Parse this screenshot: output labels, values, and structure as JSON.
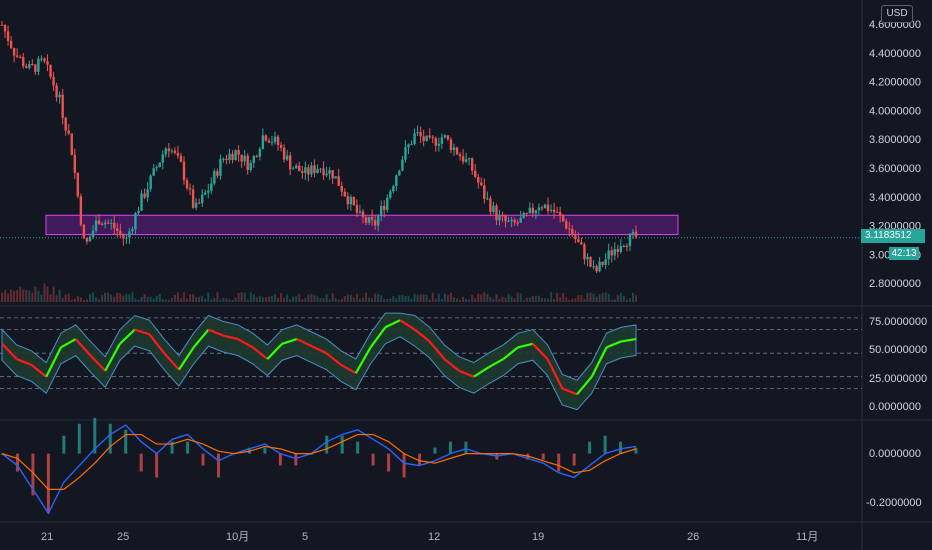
{
  "currency": "USD",
  "last_price": "3.1183512",
  "countdown": "42:13",
  "time_axis": [
    "21",
    "25",
    "10月",
    "5",
    "12",
    "19",
    "26",
    "11月"
  ],
  "price_axis": [
    "4.6000000",
    "4.4000000",
    "4.2000000",
    "4.0000000",
    "3.8000000",
    "3.6000000",
    "3.4000000",
    "3.2000000",
    "3.0000000",
    "2.8000000"
  ],
  "osc_axis": [
    "75.0000000",
    "50.0000000",
    "25.0000000",
    "0.0000000"
  ],
  "macd_axis": [
    "0.0000000",
    "-0.2000000"
  ],
  "colors": {
    "bg": "#131722",
    "up": "#26a69a",
    "down": "#ef5350",
    "zone_fill": "#7b1fa2",
    "zone_stroke": "#e040fb",
    "osc_green": "#33ff00",
    "osc_red": "#ff1a1a",
    "band": "#4a90c8",
    "macd": "#2962ff",
    "signal": "#ff6d00"
  },
  "chart_data": [
    {
      "type": "candlestick",
      "title": "",
      "y_unit": "USD",
      "ylim": [
        2.7,
        4.65
      ],
      "x_ticks": [
        "21",
        "25",
        "10月",
        "5",
        "12",
        "19",
        "26",
        "11月"
      ],
      "resistance_zone": [
        3.14,
        3.27
      ],
      "last_price": 3.1183512,
      "close_path": [
        4.55,
        4.35,
        4.25,
        4.3,
        4.1,
        3.75,
        3.05,
        3.25,
        3.2,
        3.1,
        3.35,
        3.55,
        3.75,
        3.6,
        3.3,
        3.45,
        3.65,
        3.7,
        3.6,
        3.82,
        3.75,
        3.6,
        3.55,
        3.6,
        3.55,
        3.4,
        3.25,
        3.2,
        3.4,
        3.65,
        3.82,
        3.75,
        3.8,
        3.7,
        3.6,
        3.4,
        3.25,
        3.2,
        3.25,
        3.35,
        3.3,
        3.2,
        3.05,
        2.88,
        3.0,
        3.1,
        3.12
      ]
    },
    {
      "type": "line",
      "title": "",
      "ylim": [
        0,
        85
      ],
      "levels": [
        80,
        70,
        50,
        30,
        20
      ],
      "values": [
        58,
        45,
        40,
        30,
        55,
        62,
        48,
        35,
        58,
        70,
        66,
        50,
        36,
        55,
        70,
        65,
        62,
        55,
        45,
        58,
        62,
        56,
        50,
        40,
        33,
        55,
        72,
        78,
        70,
        60,
        45,
        35,
        30,
        38,
        45,
        55,
        58,
        45,
        20,
        15,
        30,
        55,
        60,
        62
      ]
    },
    {
      "type": "line",
      "title": "",
      "ylim": [
        -0.27,
        0.12
      ],
      "series": [
        {
          "values": [
            0.0,
            -0.05,
            -0.15,
            -0.25,
            -0.12,
            -0.05,
            0.02,
            0.08,
            0.12,
            0.05,
            0.0,
            0.06,
            0.08,
            0.02,
            -0.03,
            0.0,
            0.02,
            0.04,
            0.0,
            -0.02,
            0.0,
            0.05,
            0.08,
            0.1,
            0.06,
            0.02,
            -0.04,
            -0.05,
            -0.03,
            0.0,
            0.02,
            0.0,
            -0.01,
            0.0,
            -0.02,
            -0.04,
            -0.08,
            -0.1,
            -0.05,
            0.0,
            0.02,
            0.03
          ]
        },
        {
          "values": [
            0.0,
            -0.02,
            -0.08,
            -0.15,
            -0.15,
            -0.1,
            -0.04,
            0.03,
            0.08,
            0.08,
            0.04,
            0.04,
            0.06,
            0.04,
            0.01,
            0.0,
            0.01,
            0.03,
            0.02,
            0.0,
            0.0,
            0.02,
            0.05,
            0.08,
            0.08,
            0.05,
            0.0,
            -0.03,
            -0.04,
            -0.02,
            0.0,
            0.0,
            0.0,
            0.0,
            -0.01,
            -0.03,
            -0.05,
            -0.08,
            -0.07,
            -0.03,
            0.0,
            0.02
          ]
        }
      ]
    }
  ]
}
